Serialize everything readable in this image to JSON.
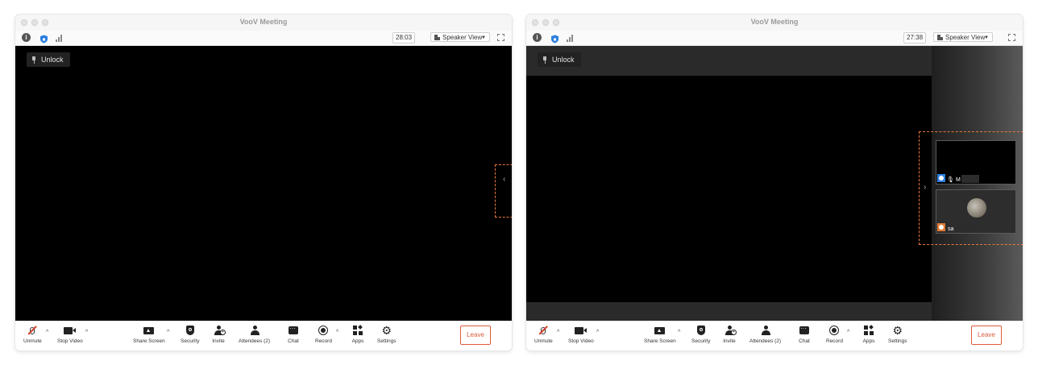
{
  "windows": [
    {
      "title": "VooV Meeting",
      "timer": "28:03",
      "view_mode": "Speaker View",
      "unlock_label": "Unlock",
      "toolbar": {
        "unmute": "Unmute",
        "stop_video": "Stop Video",
        "share_screen": "Share Screen",
        "security": "Security",
        "invite": "Invite",
        "attendees": "Attendees (2)",
        "chat": "Chat",
        "record": "Record",
        "apps": "Apps",
        "settings": "Settings",
        "leave": "Leave"
      },
      "expand_arrow": "‹"
    },
    {
      "title": "VooV Meeting",
      "timer": "27:38",
      "view_mode": "Speaker View",
      "unlock_label": "Unlock",
      "participants": [
        {
          "name": "M",
          "avatar_color": "#2d7fe0"
        },
        {
          "name": "sa",
          "avatar_color": "#e07a35"
        }
      ],
      "toolbar": {
        "unmute": "Unmute",
        "stop_video": "Stop Video",
        "share_screen": "Share Screen",
        "security": "Security",
        "invite": "Invite",
        "attendees": "Attendees (2)",
        "chat": "Chat",
        "record": "Record",
        "apps": "Apps",
        "settings": "Settings",
        "leave": "Leave"
      },
      "collapse_arrow": "›"
    }
  ],
  "colors": {
    "accent_leave": "#e05a3a",
    "highlight_dash": "#e9773e",
    "security_blue": "#2d7fe0"
  }
}
